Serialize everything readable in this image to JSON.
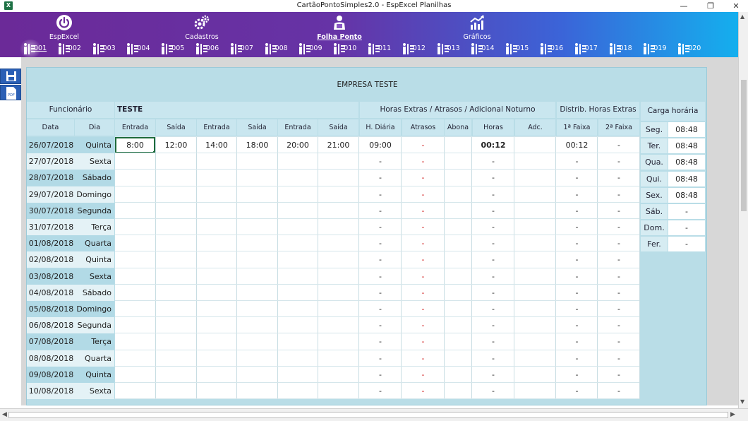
{
  "window": {
    "title": "CartãoPontoSimples2.0 - EspExcel Planilhas",
    "app_icon": "X",
    "controls": [
      "—",
      "❐",
      "✕"
    ]
  },
  "ribbon": {
    "menu": [
      {
        "label": "EspExcel",
        "icon": "power-icon"
      },
      {
        "label": "Cadastros",
        "icon": "gears-icon"
      },
      {
        "label": "Folha Ponto",
        "icon": "timesheet-icon",
        "active": true
      },
      {
        "label": "Gráficos",
        "icon": "chart-icon"
      }
    ],
    "months": [
      "001",
      "002",
      "003",
      "004",
      "005",
      "006",
      "007",
      "008",
      "009",
      "010",
      "011",
      "012",
      "013",
      "014",
      "015",
      "016",
      "017",
      "018",
      "019",
      "020"
    ],
    "active_month": "001"
  },
  "side_buttons": [
    {
      "name": "save-icon"
    },
    {
      "name": "pdf-icon",
      "label": "PDF"
    }
  ],
  "sheet": {
    "company": "EMPRESA TESTE",
    "employee_label": "Funcionário",
    "employee_name": "TESTE",
    "group_headers": {
      "extras": "Horas Extras  /  Atrasos  /  Adicional Noturno",
      "distrib": "Distrib. Horas Extras",
      "carga": "Carga horária"
    },
    "columns": [
      "Data",
      "Dia Semana",
      "Entrada",
      "Saída",
      "Entrada",
      "Saída",
      "Entrada",
      "Saída",
      "H. Diária",
      "Atrasos",
      "Abona",
      "Horas Extras",
      "Adc. Noturno",
      "1ª Faixa",
      "2ª Faixa"
    ],
    "rows": [
      {
        "data": "26/07/2018",
        "dia": "Quinta",
        "e1": "8:00",
        "s1": "12:00",
        "e2": "14:00",
        "s2": "18:00",
        "e3": "20:00",
        "s3": "21:00",
        "hd": "09:00",
        "atr": "-",
        "abona": "",
        "he": "00:12",
        "adc": "",
        "f1": "00:12",
        "f2": "-"
      },
      {
        "data": "27/07/2018",
        "dia": "Sexta",
        "e1": "",
        "s1": "",
        "e2": "",
        "s2": "",
        "e3": "",
        "s3": "",
        "hd": "-",
        "atr": "-",
        "abona": "",
        "he": "-",
        "adc": "",
        "f1": "-",
        "f2": "-"
      },
      {
        "data": "28/07/2018",
        "dia": "Sábado",
        "e1": "",
        "s1": "",
        "e2": "",
        "s2": "",
        "e3": "",
        "s3": "",
        "hd": "-",
        "atr": "-",
        "abona": "",
        "he": "-",
        "adc": "",
        "f1": "-",
        "f2": "-"
      },
      {
        "data": "29/07/2018",
        "dia": "Domingo",
        "e1": "",
        "s1": "",
        "e2": "",
        "s2": "",
        "e3": "",
        "s3": "",
        "hd": "-",
        "atr": "-",
        "abona": "",
        "he": "-",
        "adc": "",
        "f1": "-",
        "f2": "-"
      },
      {
        "data": "30/07/2018",
        "dia": "Segunda",
        "e1": "",
        "s1": "",
        "e2": "",
        "s2": "",
        "e3": "",
        "s3": "",
        "hd": "-",
        "atr": "-",
        "abona": "",
        "he": "-",
        "adc": "",
        "f1": "-",
        "f2": "-"
      },
      {
        "data": "31/07/2018",
        "dia": "Terça",
        "e1": "",
        "s1": "",
        "e2": "",
        "s2": "",
        "e3": "",
        "s3": "",
        "hd": "-",
        "atr": "-",
        "abona": "",
        "he": "-",
        "adc": "",
        "f1": "-",
        "f2": "-"
      },
      {
        "data": "01/08/2018",
        "dia": "Quarta",
        "e1": "",
        "s1": "",
        "e2": "",
        "s2": "",
        "e3": "",
        "s3": "",
        "hd": "-",
        "atr": "-",
        "abona": "",
        "he": "-",
        "adc": "",
        "f1": "-",
        "f2": "-"
      },
      {
        "data": "02/08/2018",
        "dia": "Quinta",
        "e1": "",
        "s1": "",
        "e2": "",
        "s2": "",
        "e3": "",
        "s3": "",
        "hd": "-",
        "atr": "-",
        "abona": "",
        "he": "-",
        "adc": "",
        "f1": "-",
        "f2": "-"
      },
      {
        "data": "03/08/2018",
        "dia": "Sexta",
        "e1": "",
        "s1": "",
        "e2": "",
        "s2": "",
        "e3": "",
        "s3": "",
        "hd": "-",
        "atr": "-",
        "abona": "",
        "he": "-",
        "adc": "",
        "f1": "-",
        "f2": "-"
      },
      {
        "data": "04/08/2018",
        "dia": "Sábado",
        "e1": "",
        "s1": "",
        "e2": "",
        "s2": "",
        "e3": "",
        "s3": "",
        "hd": "-",
        "atr": "-",
        "abona": "",
        "he": "-",
        "adc": "",
        "f1": "-",
        "f2": "-"
      },
      {
        "data": "05/08/2018",
        "dia": "Domingo",
        "e1": "",
        "s1": "",
        "e2": "",
        "s2": "",
        "e3": "",
        "s3": "",
        "hd": "-",
        "atr": "-",
        "abona": "",
        "he": "-",
        "adc": "",
        "f1": "-",
        "f2": "-"
      },
      {
        "data": "06/08/2018",
        "dia": "Segunda",
        "e1": "",
        "s1": "",
        "e2": "",
        "s2": "",
        "e3": "",
        "s3": "",
        "hd": "-",
        "atr": "-",
        "abona": "",
        "he": "-",
        "adc": "",
        "f1": "-",
        "f2": "-"
      },
      {
        "data": "07/08/2018",
        "dia": "Terça",
        "e1": "",
        "s1": "",
        "e2": "",
        "s2": "",
        "e3": "",
        "s3": "",
        "hd": "-",
        "atr": "-",
        "abona": "",
        "he": "-",
        "adc": "",
        "f1": "-",
        "f2": "-"
      },
      {
        "data": "08/08/2018",
        "dia": "Quarta",
        "e1": "",
        "s1": "",
        "e2": "",
        "s2": "",
        "e3": "",
        "s3": "",
        "hd": "-",
        "atr": "-",
        "abona": "",
        "he": "-",
        "adc": "",
        "f1": "-",
        "f2": "-"
      },
      {
        "data": "09/08/2018",
        "dia": "Quinta",
        "e1": "",
        "s1": "",
        "e2": "",
        "s2": "",
        "e3": "",
        "s3": "",
        "hd": "-",
        "atr": "-",
        "abona": "",
        "he": "-",
        "adc": "",
        "f1": "-",
        "f2": "-"
      },
      {
        "data": "10/08/2018",
        "dia": "Sexta",
        "e1": "",
        "s1": "",
        "e2": "",
        "s2": "",
        "e3": "",
        "s3": "",
        "hd": "-",
        "atr": "-",
        "abona": "",
        "he": "-",
        "adc": "",
        "f1": "-",
        "f2": "-"
      }
    ],
    "carga_horaria": [
      {
        "dia": "Seg.",
        "horas": "08:48"
      },
      {
        "dia": "Ter.",
        "horas": "08:48"
      },
      {
        "dia": "Qua.",
        "horas": "08:48"
      },
      {
        "dia": "Qui.",
        "horas": "08:48"
      },
      {
        "dia": "Sex.",
        "horas": "08:48"
      },
      {
        "dia": "Sáb.",
        "horas": "-"
      },
      {
        "dia": "Dom.",
        "horas": "-"
      },
      {
        "dia": "Fer.",
        "horas": "-"
      }
    ]
  },
  "colors": {
    "ribbon_start": "#6b2a98",
    "ribbon_end": "#12b3ef",
    "sheet_bg": "#b9dde7",
    "header_bg": "#c9e6ef",
    "date_shaded": "#b2dae6",
    "late_red": "#d01818",
    "selection_green": "#1e6b3c"
  }
}
